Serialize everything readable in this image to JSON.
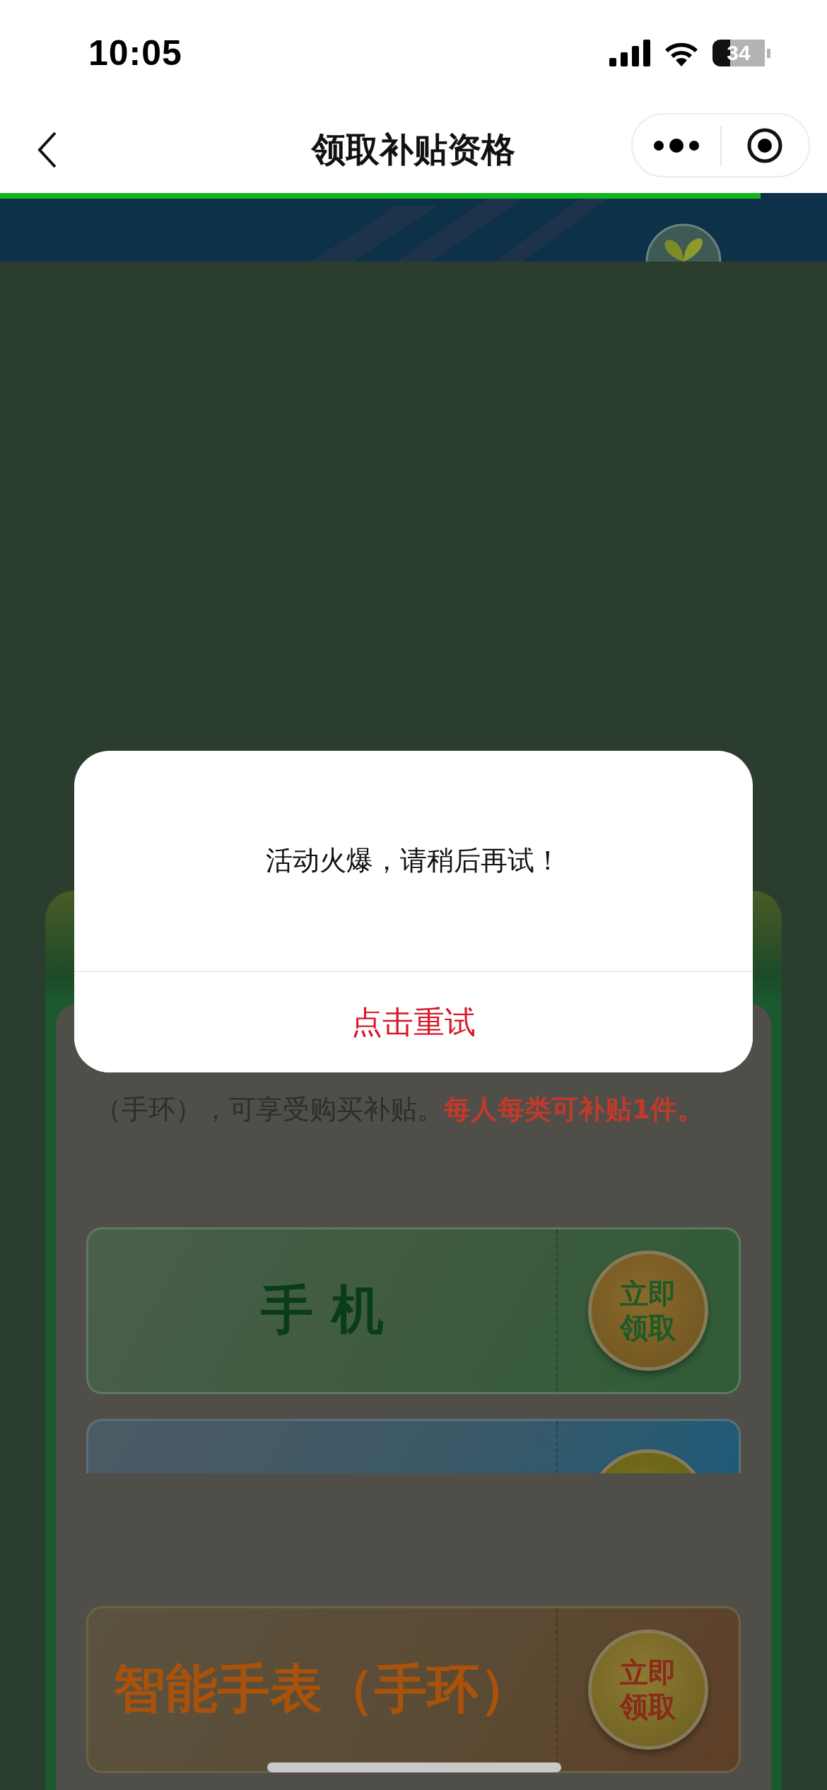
{
  "status_bar": {
    "time": "10:05",
    "battery": "34"
  },
  "nav": {
    "title": "领取补贴资格"
  },
  "load_progress": {
    "level": 0.92
  },
  "notice": {
    "text": "（手环），可享受购买补贴。**每人每类可补贴1件。**"
  },
  "subsidy_cards": [
    {
      "kind": "green",
      "label": "手 机",
      "button": "立即领取"
    },
    {
      "kind": "blue"
    },
    {
      "kind": "orange",
      "label": "智能手表（手环）",
      "button": "立即领取"
    }
  ],
  "dialog": {
    "message": "活动火爆，请稍后再试！",
    "button": "点击重试"
  }
}
